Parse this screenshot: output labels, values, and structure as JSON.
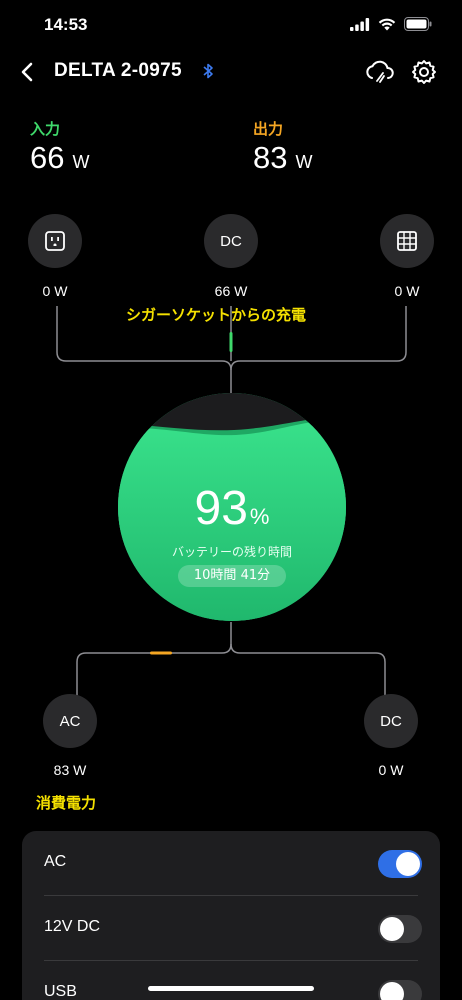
{
  "status_bar": {
    "time": "14:53"
  },
  "nav": {
    "title": "DELTA 2-0975"
  },
  "input": {
    "label": "入力",
    "value": "66",
    "unit": "W"
  },
  "output": {
    "label": "出力",
    "value": "83",
    "unit": "W"
  },
  "input_nodes": [
    {
      "name": "ac-outlet",
      "icon": "outlet-icon",
      "text": "",
      "value": "0 W"
    },
    {
      "name": "dc",
      "icon": "",
      "text": "DC",
      "value": "66 W"
    },
    {
      "name": "solar",
      "icon": "solar-panel-icon",
      "text": "",
      "value": "0 W"
    }
  ],
  "annotation_input": "シガーソケットからの充電",
  "battery": {
    "percent": "93",
    "percent_sign": "%",
    "label": "バッテリーの残り時間",
    "time_remaining": "10時間 41分",
    "level": 0.93
  },
  "output_nodes": [
    {
      "name": "ac",
      "text": "AC",
      "value": "83 W"
    },
    {
      "name": "dc",
      "text": "DC",
      "value": "0 W"
    }
  ],
  "annotation_output": "消費電力",
  "colors": {
    "input_label": "#3fd96b",
    "output_label": "#f5a623",
    "accent_green": "#24c77a",
    "toggle_on": "#2f6fe6",
    "annotation": "#f5e100"
  },
  "toggles": [
    {
      "label": "AC",
      "on": true
    },
    {
      "label": "12V DC",
      "on": false
    },
    {
      "label": "USB",
      "on": false
    }
  ]
}
